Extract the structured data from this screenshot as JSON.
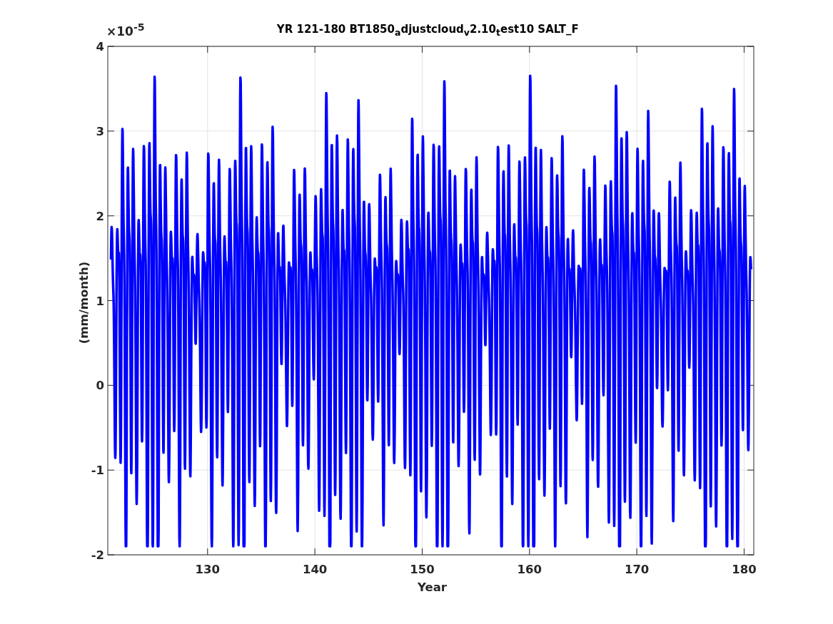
{
  "figure": {
    "title": "YR 121-180 BT1850$_{a}$djustcloud$_{v}$2.10$_{t}$est10 SALT_F",
    "y_exponent": "×10$^{-5}$",
    "xlabel": "Year",
    "ylabel": "(mm/month)",
    "x_tick_labels": [
      "130",
      "140",
      "150",
      "160",
      "170",
      "180"
    ],
    "y_tick_labels": [
      "4",
      "3",
      "2",
      "1",
      "0",
      "-1",
      "-2"
    ]
  }
}
